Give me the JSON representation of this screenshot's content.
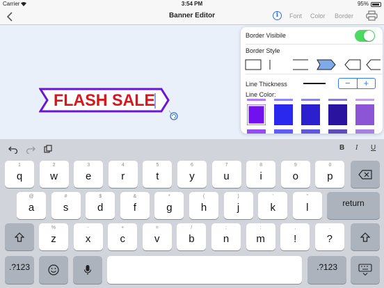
{
  "status_bar": {
    "carrier": "Carrier",
    "time": "3:54 PM",
    "battery": "95%"
  },
  "nav": {
    "back_icon": "chevron-left-icon",
    "title": "Banner Editor",
    "info_glyph": "i",
    "tabs": [
      "Font",
      "Color",
      "Border"
    ],
    "print_icon": "printer-icon"
  },
  "banner": {
    "text": "FLASH SALE",
    "text_color": "#d9161b",
    "border_color": "#6a14d6"
  },
  "border_panel": {
    "visible_label": "Border Visibile",
    "visible_on": true,
    "style_label": "Border Style",
    "thickness_label": "Line Thickness",
    "stepper_minus": "−",
    "stepper_plus": "+",
    "color_label": "Line Color:",
    "swatch_colors": [
      "#7211ee",
      "#2a27ee",
      "#2b1fcf",
      "#2a139f",
      "#8b55d6"
    ],
    "selected_swatch": 0
  },
  "keyboard": {
    "tools": {
      "undo": "undo-icon",
      "redo": "redo-icon",
      "paste": "paste-icon",
      "bold": "B",
      "italic": "I",
      "underline": "U"
    },
    "row1": [
      {
        "k": "q",
        "a": "1"
      },
      {
        "k": "w",
        "a": "2"
      },
      {
        "k": "e",
        "a": "3"
      },
      {
        "k": "r",
        "a": "4"
      },
      {
        "k": "t",
        "a": "5"
      },
      {
        "k": "y",
        "a": "6"
      },
      {
        "k": "u",
        "a": "7"
      },
      {
        "k": "i",
        "a": "8"
      },
      {
        "k": "o",
        "a": "9"
      },
      {
        "k": "p",
        "a": "0"
      }
    ],
    "row2": [
      {
        "k": "a",
        "a": "@"
      },
      {
        "k": "s",
        "a": "#"
      },
      {
        "k": "d",
        "a": "$"
      },
      {
        "k": "f",
        "a": "&"
      },
      {
        "k": "g",
        "a": "*"
      },
      {
        "k": "h",
        "a": "("
      },
      {
        "k": "j",
        "a": ")"
      },
      {
        "k": "k",
        "a": "'"
      },
      {
        "k": "l",
        "a": "\""
      }
    ],
    "row3": [
      {
        "k": "z",
        "a": "%"
      },
      {
        "k": "x",
        "a": "-"
      },
      {
        "k": "c",
        "a": "+"
      },
      {
        "k": "v",
        "a": "="
      },
      {
        "k": "b",
        "a": "/"
      },
      {
        "k": "n",
        "a": ";"
      },
      {
        "k": "m",
        "a": ":"
      },
      {
        "k": "!",
        "a": ","
      },
      {
        "k": "?",
        "a": "."
      }
    ],
    "return_label": "return",
    "numbers_label": ".?123"
  }
}
